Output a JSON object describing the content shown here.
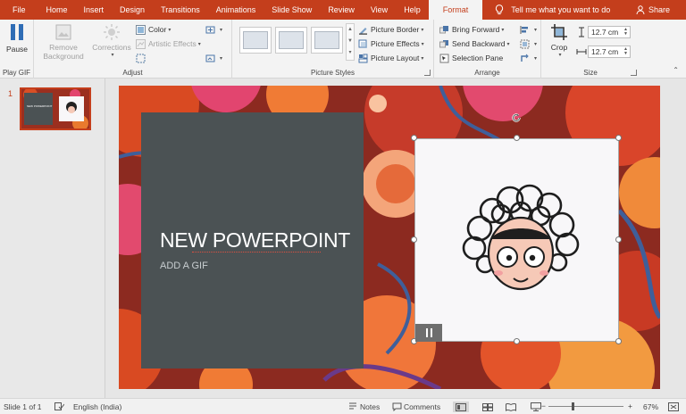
{
  "tabs": [
    "File",
    "Home",
    "Insert",
    "Design",
    "Transitions",
    "Animations",
    "Slide Show",
    "Review",
    "View",
    "Help",
    "Format"
  ],
  "active_tab": "Format",
  "tell_me": "Tell me what you want to do",
  "share": "Share",
  "ribbon": {
    "play_gif": {
      "pause": "Pause",
      "group": "Play GIF"
    },
    "adjust": {
      "remove_background_1": "Remove",
      "remove_background_2": "Background",
      "corrections": "Corrections",
      "color": "Color",
      "artistic_effects": "Artistic Effects",
      "group": "Adjust"
    },
    "picture_styles": {
      "picture_border": "Picture Border",
      "picture_effects": "Picture Effects",
      "picture_layout": "Picture Layout",
      "group": "Picture Styles"
    },
    "arrange": {
      "bring_forward": "Bring Forward",
      "send_backward": "Send Backward",
      "selection_pane": "Selection Pane",
      "group": "Arrange"
    },
    "size": {
      "crop": "Crop",
      "height": "12.7 cm",
      "width": "12.7 cm",
      "group": "Size"
    }
  },
  "slides_pane": {
    "slide_number": "1",
    "thumb_title": "NEW POWERPOINT"
  },
  "slide": {
    "title": "NEW POWERPOINT",
    "subtitle": "ADD A GIF"
  },
  "status": {
    "slide_info": "Slide 1 of 1",
    "language": "English (India)",
    "notes": "Notes",
    "comments": "Comments",
    "zoom_minus": "−",
    "zoom_plus": "+",
    "zoom": "67%",
    "zoom_level": 0.67
  },
  "colors": {
    "accent": "#c43e1c",
    "panel": "#4b5254",
    "ribbon": "#f3f3f3"
  }
}
